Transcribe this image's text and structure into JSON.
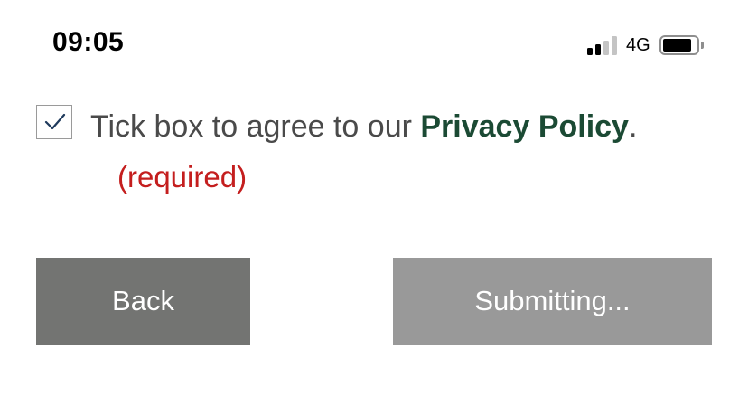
{
  "status_bar": {
    "time": "09:05",
    "network": "4G",
    "signal_bars_active": 2,
    "signal_bars_total": 4,
    "battery_level": 0.85
  },
  "consent": {
    "checked": true,
    "text_before": "Tick box to agree to our ",
    "link_text": "Privacy Policy",
    "text_after": ".",
    "required_note": "(required)"
  },
  "buttons": {
    "back_label": "Back",
    "submit_label": "Submitting..."
  },
  "colors": {
    "link": "#1b4a34",
    "required": "#c41e1e",
    "back_button": "#737472",
    "submit_button": "#999999",
    "text": "#4a4a4a"
  },
  "icons": {
    "checkbox": "checkmark-icon",
    "signal": "signal-strength-icon",
    "battery": "battery-icon"
  }
}
